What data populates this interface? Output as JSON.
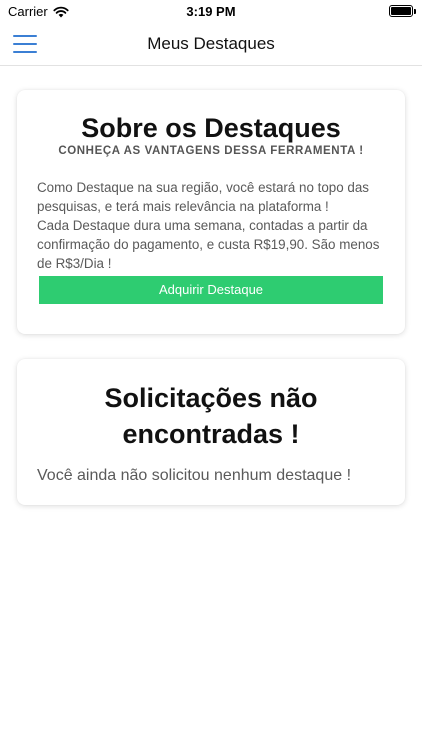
{
  "status_bar": {
    "carrier": "Carrier",
    "time": "3:19 PM",
    "icons": [
      "wifi-icon",
      "battery-icon"
    ]
  },
  "nav": {
    "title": "Meus Destaques",
    "menu_icon": "hamburger-menu-icon",
    "accent_color": "#3b7fd4"
  },
  "about_card": {
    "title": "Sobre os Destaques",
    "subtitle": "CONHEÇA AS VANTAGENS DESSA FERRAMENTA !",
    "paragraph_1": "Como Destaque na sua região, você estará no topo das pesquisas, e terá mais relevância na plataforma !",
    "paragraph_2": "Cada Destaque dura uma semana, contadas a partir da confirmação do pagamento, e custa R$19,90. São menos de R$3/Dia !",
    "button_label": "Adquirir Destaque",
    "button_color": "#2ecc71"
  },
  "requests_card": {
    "title": "Solicitações não encontradas !",
    "message": "Você ainda não solicitou nenhum destaque !"
  }
}
